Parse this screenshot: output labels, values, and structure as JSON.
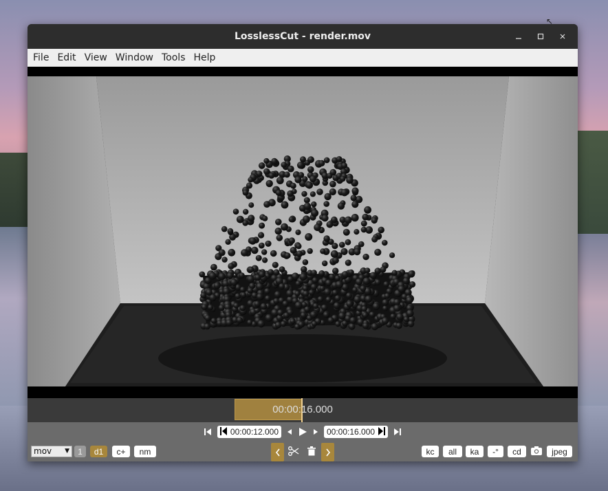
{
  "window": {
    "title": "LosslessCut - render.mov",
    "controls": {
      "minimize": "_",
      "maximize": "☐",
      "close": "×"
    }
  },
  "menu": [
    "File",
    "Edit",
    "View",
    "Window",
    "Tools",
    "Help"
  ],
  "timeline": {
    "current_time": "00:00:16.000"
  },
  "transport": {
    "cut_start": "00:00:12.000",
    "cut_end": "00:00:16.000"
  },
  "bottom": {
    "format_select": "mov",
    "stream_count": "1",
    "segment_label": "d1",
    "add_segment": "c+",
    "nm_label": "nm",
    "right_buttons": [
      "kc",
      "all",
      "ka",
      "-°",
      "cd"
    ],
    "jpeg_label": "jpeg"
  },
  "icons": {
    "prev": "skip-back-icon",
    "next": "skip-forward-icon",
    "play": "play-icon",
    "scissors": "scissors-icon",
    "trash": "trash-icon",
    "camera": "camera-icon"
  },
  "colors": {
    "accent": "#a8873c"
  }
}
